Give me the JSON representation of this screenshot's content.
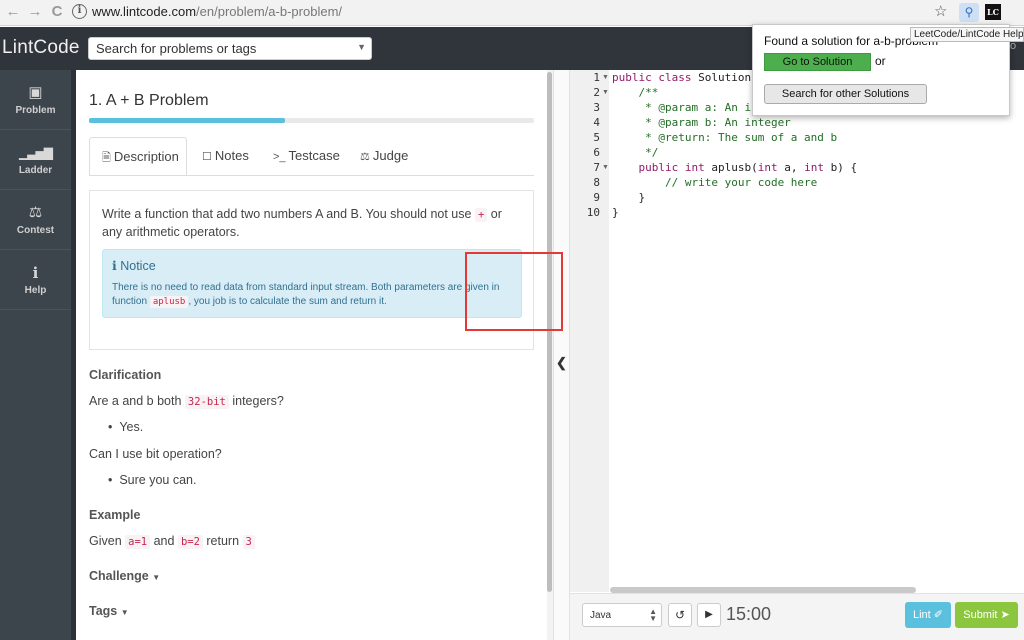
{
  "browser": {
    "back_glyph": "←",
    "forward_glyph": "→",
    "reload_glyph": "C",
    "url_domain": "www.lintcode.com",
    "url_path": "/en/problem/a-b-problem/",
    "tooltip": "LeetCode/LintCode Helper",
    "lc_icon_text": "LC"
  },
  "navbar": {
    "logo": "LintCode",
    "search_placeholder": "Search for problems or tags",
    "right_fragment": "o"
  },
  "sidebar": {
    "items": [
      {
        "label": "Problem",
        "icon": "puzzle-icon"
      },
      {
        "label": "Ladder",
        "icon": "signal-icon"
      },
      {
        "label": "Contest",
        "icon": "trophy-icon"
      },
      {
        "label": "Help",
        "icon": "info-icon"
      }
    ]
  },
  "problem": {
    "title": "1. A + B Problem",
    "progress": 0.44,
    "tabs": [
      "Description",
      "Notes",
      "Testcase",
      "Judge"
    ],
    "desc_1": "Write a function that add two numbers A and B. You should not use",
    "desc_plus": "+",
    "desc_2": "or any arithmetic operators.",
    "notice_title": "Notice",
    "notice_1": "There is no need to read data from standard input stream. Both parameters are given in function",
    "notice_code": "aplusb",
    "notice_2": ", you job is to calculate the sum and return it.",
    "clarification_head": "Clarification",
    "q1_a": "Are a and b both",
    "q1_code": "32-bit",
    "q1_b": "integers?",
    "a1": "Yes.",
    "q2": "Can I use bit operation?",
    "a2": "Sure you can.",
    "example_head": "Example",
    "ex_given": "Given",
    "ex_a": "a=1",
    "ex_and": "and",
    "ex_b": "b=2",
    "ex_return": "return",
    "ex_result": "3",
    "challenge": "Challenge",
    "tags": "Tags"
  },
  "editor": {
    "line_numbers": [
      "1",
      "2",
      "3",
      "4",
      "5",
      "6",
      "7",
      "8",
      "9",
      "10"
    ],
    "l1_kw": "public class",
    "l1_rest": " Solution {",
    "l2": "    /**",
    "l3": "     * @param a: An integer",
    "l4": "     * @param b: An integer",
    "l5": "     * @return: The sum of a and b",
    "l6": "     */",
    "l7_kw": "    public int",
    "l7_mid": " aplusb(",
    "l7_t1": "int",
    "l7_a": " a, ",
    "l7_t2": "int",
    "l7_b": " b) {",
    "l8": "        // write your code here",
    "l9": "    }",
    "l10": "}"
  },
  "footer": {
    "language": "Java",
    "timer": "15:00",
    "lint_label": "Lint",
    "submit_label": "Submit"
  },
  "popup": {
    "message": "Found a solution for a-b-problem",
    "go_button": "Go to Solution",
    "or_text": "or",
    "search_button": "Search for other Solutions"
  },
  "colors": {
    "navbar": "#30353b",
    "sidebar": "#3c444c",
    "accent_blue": "#5bc0de",
    "submit_green": "#8cc63f",
    "popup_green": "#4cae4c",
    "annotation_red": "#e53935"
  }
}
